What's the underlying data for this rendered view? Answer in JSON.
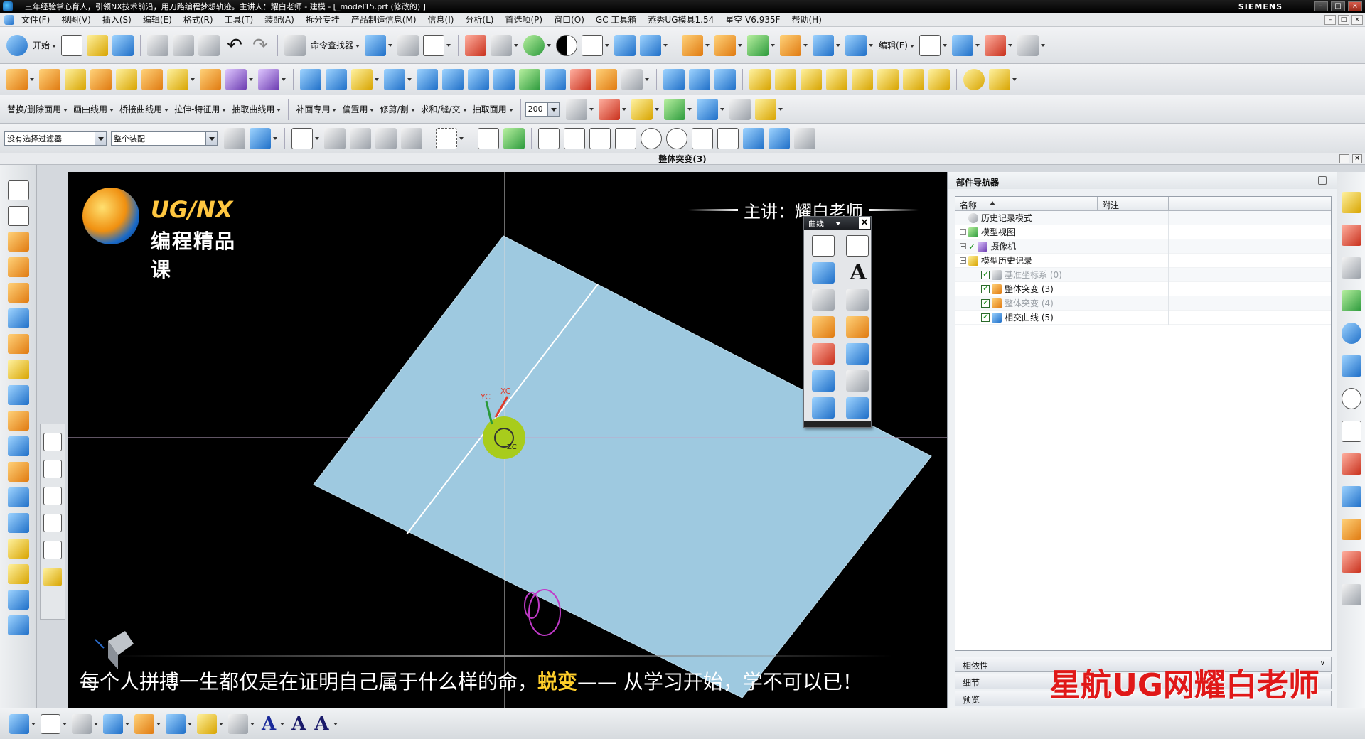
{
  "window": {
    "title": "十三年经验掌心育人，引领NX技术前沿，用刀路编程梦想轨迹。主讲人：耀白老师 - 建模 - [_model15.prt  (修改的) ]",
    "brand": "SIEMENS",
    "controls": [
      "–",
      "□",
      "×"
    ]
  },
  "menu": {
    "items": [
      "文件(F)",
      "视图(V)",
      "插入(S)",
      "编辑(E)",
      "格式(R)",
      "工具(T)",
      "装配(A)",
      "拆分专挂",
      "产品制造信息(M)",
      "信息(I)",
      "分析(L)",
      "首选项(P)",
      "窗口(O)",
      "GC 工具箱",
      "燕秀UG模具1.54",
      "星空 V6.935F",
      "帮助(H)"
    ]
  },
  "toolbar1": {
    "start_label": "开始",
    "command_finder_label": "命令查找器",
    "edit_label": "编辑(E)"
  },
  "toolbar3": {
    "menus": [
      "替换/删除面用",
      "画曲线用",
      "桥接曲线用",
      "拉伸-特征用",
      "抽取曲线用",
      "补面专用",
      "偏置用",
      "修剪/割",
      "求和/缝/交",
      "抽取面用"
    ],
    "zoom_value": "200"
  },
  "selection_bar": {
    "filter_value": "没有选择过滤器",
    "scope_value": "整个装配"
  },
  "status": {
    "prompt": "整体突变(3)"
  },
  "viewport": {
    "logo_line1": "UG/NX",
    "logo_line2": "编程精品课",
    "presenter": "主讲：耀白老师",
    "subtitle_before": "每个人拼搏一生都仅是在证明自己属于什么样的命，",
    "subtitle_highlight": "蜕变",
    "subtitle_after": "—— 从学习开始，学不可以已！",
    "axis_labels": {
      "xc": "XC",
      "yc": "YC",
      "zc": "ZC"
    },
    "sheet_color": "#9ec9e0",
    "background_color": "#000000"
  },
  "curve_toolbar": {
    "title": "曲线",
    "text_tool_glyph": "A"
  },
  "navigator": {
    "title": "部件导航器",
    "columns": [
      "名称",
      "附注"
    ],
    "rows": [
      {
        "label": "历史记录模式",
        "level": 0,
        "expander": "",
        "check": false,
        "dim": false
      },
      {
        "label": "模型视图",
        "level": 0,
        "expander": "+",
        "check": false,
        "dim": false
      },
      {
        "label": "摄像机",
        "level": 0,
        "expander": "+",
        "check": true,
        "dim": false
      },
      {
        "label": "模型历史记录",
        "level": 0,
        "expander": "−",
        "check": false,
        "dim": false
      },
      {
        "label": "基准坐标系 (0)",
        "level": 1,
        "expander": "",
        "check": true,
        "dim": true
      },
      {
        "label": "整体突变 (3)",
        "level": 1,
        "expander": "",
        "check": true,
        "dim": false
      },
      {
        "label": "整体突变 (4)",
        "level": 1,
        "expander": "",
        "check": true,
        "dim": true
      },
      {
        "label": "相交曲线 (5)",
        "level": 1,
        "expander": "",
        "check": true,
        "dim": false
      }
    ],
    "panels": [
      "相依性",
      "细节",
      "预览"
    ]
  },
  "watermark": "星航UG网耀白老师"
}
